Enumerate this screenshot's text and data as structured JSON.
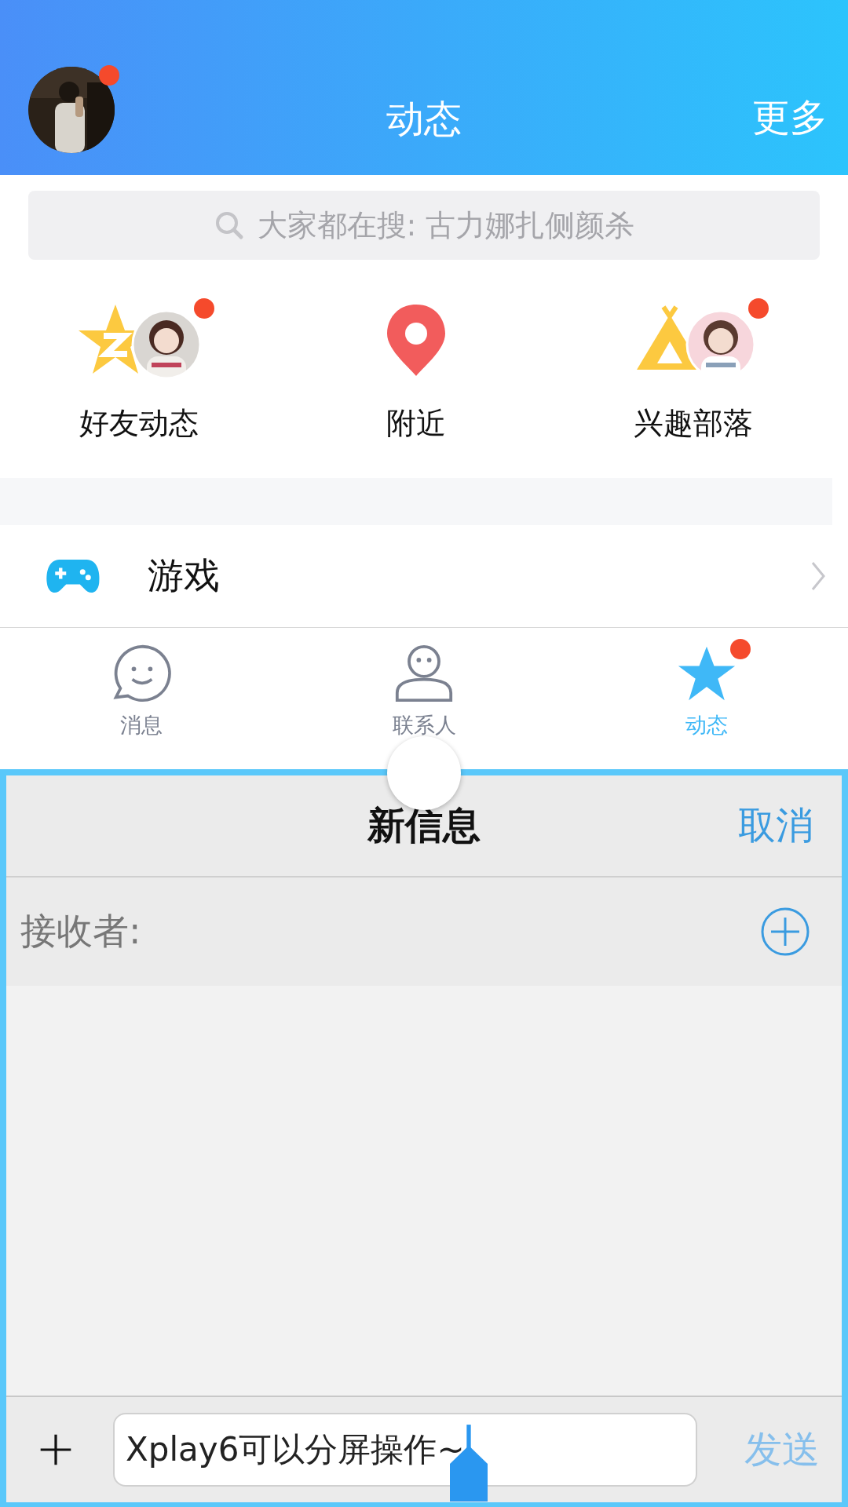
{
  "header": {
    "title": "动态",
    "more": "更多",
    "avatar_badge": true
  },
  "search": {
    "placeholder": "大家都在搜: 古力娜扎侧颜杀"
  },
  "shortcuts": [
    {
      "label": "好友动态",
      "avatar": true,
      "badge": true
    },
    {
      "label": "附近",
      "avatar": false,
      "badge": false
    },
    {
      "label": "兴趣部落",
      "avatar": true,
      "badge": true
    }
  ],
  "list": [
    {
      "label": "游戏"
    }
  ],
  "tabs": [
    {
      "label": "消息",
      "selected": false,
      "badge": false
    },
    {
      "label": "联系人",
      "selected": false,
      "badge": false
    },
    {
      "label": "动态",
      "selected": true,
      "badge": true
    }
  ],
  "compose": {
    "title": "新信息",
    "cancel": "取消",
    "recipient_label": "接收者:",
    "message": "Xplay6可以分屏操作~",
    "send": "发送",
    "send_disabled": true
  }
}
